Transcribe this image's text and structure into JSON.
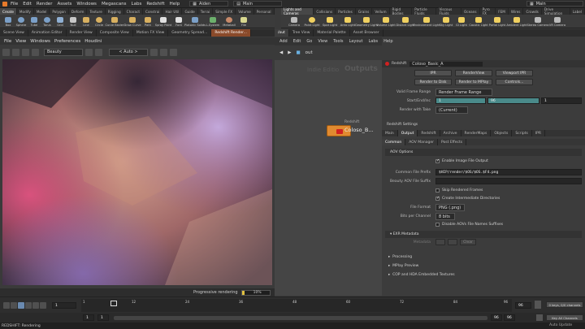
{
  "menubar": {
    "items": [
      "File",
      "Edit",
      "Render",
      "Assets",
      "Windows",
      "Megascans",
      "Labs",
      "Redshift",
      "Help"
    ],
    "desktop_left": "Aiden",
    "desktop_right": "Main",
    "desktop_far": "Main"
  },
  "shelf_left": {
    "tabs": [
      "Create",
      "Modify",
      "Model",
      "Polygon",
      "Deform",
      "Texture",
      "Rigging",
      "Charact",
      "Constrai",
      "Hair Util",
      "Guide",
      "Terrai",
      "Simple FX",
      "Volume",
      "Personal"
    ],
    "tools": [
      "Box",
      "Sphere",
      "Tube",
      "Torus",
      "Grid",
      "Null",
      "Line",
      "Circle",
      "Curve Bezier",
      "Draw Curve",
      "Path",
      "Spray Paint",
      "Font",
      "Platonic Solids",
      "L-System",
      "Metaball",
      "File"
    ]
  },
  "shelf_right": {
    "tabs": [
      "Lights and Cameras",
      "Collisions",
      "Particles",
      "Grains",
      "Vellum",
      "Rigid Bodies",
      "Particle Fluids",
      "Viscous Fluids",
      "Oceans",
      "Pyro FX",
      "FEM",
      "Wires",
      "Crowds",
      "Drive Simulation",
      "Label"
    ],
    "tools": [
      "Camera",
      "Point Light",
      "Spot Light",
      "Area Light",
      "Geometry Light",
      "Volume Light",
      "Distant Light",
      "Environment Light",
      "Sky Light",
      "GI Light",
      "Caustic Light",
      "Portal Light",
      "Ambient Light",
      "Stereo Camera",
      "VR Camera"
    ]
  },
  "panel_tabs_left": [
    "Scene View",
    "Animation Editor",
    "Render View",
    "Composite View",
    "Motion FX View",
    "Geometry Spread...",
    "Redshift Render..."
  ],
  "panel_tabs_right": [
    "/out",
    "Tree View",
    "Material Palette",
    "Asset Browser"
  ],
  "viewport": {
    "menu": [
      "File",
      "View",
      "Windows",
      "Preferences",
      "Houdini"
    ],
    "aov": "Beauty",
    "zoom": "< Auto >",
    "status": "Progressive rendering",
    "progress": "10%"
  },
  "node_panel": {
    "menu": [
      "Add",
      "Edit",
      "Go",
      "View",
      "Tools",
      "Layout",
      "Labs",
      "Help"
    ],
    "path": "out",
    "watermark_left": "Indie Editio",
    "watermark_right": "Outputs",
    "node_type": "Redshift",
    "node_name": "Coloso_B..."
  },
  "parm": {
    "header_type": "Redshift",
    "header_name": "Coloso_Basic_A",
    "buttons_row1": [
      "IPR",
      "RenderView",
      "Viewport IPR"
    ],
    "buttons_row2": [
      "Render to Disk",
      "Render to MPlay",
      "Controls..."
    ],
    "valid_frame_range_label": "Valid Frame Range",
    "valid_frame_range": "Render Frame Range",
    "start_end_label": "Start/End/Inc",
    "start": "1",
    "end": "96",
    "inc": "1",
    "render_with_take_label": "Render with Take",
    "render_with_take": "(Current)",
    "settings_label": "Redshift Settings",
    "tabs": [
      "Main",
      "Output",
      "Redshift",
      "Archive",
      "RenderMaps",
      "Objects",
      "Scripts",
      "IPR"
    ],
    "subtabs": [
      "Common",
      "AOV Manager",
      "Post Effects"
    ],
    "aov_options": "AOV Options",
    "enable_output": "Enable Image File Output",
    "prefix_label": "Common File Prefix",
    "prefix": "$HIP/render/$OS/$OS.$F4.png",
    "beauty_suffix_label": "Beauty AOV File Suffix",
    "skip_rendered": "Skip Rendered Frames",
    "create_dirs": "Create Intermediate Directories",
    "file_format_label": "File Format",
    "file_format": "PNG (.png)",
    "bits_label": "Bits per Channel",
    "bits": "8 bits",
    "disable_aov_suffix": "Disable AOVs File Names Suffixes",
    "exr_metadata": "EXR Metadata",
    "metadata_label": "Metadata",
    "clear": "Clear",
    "collapsed": [
      "Processing",
      "MPlay Preview",
      "COP and HDA Embedded Textures"
    ]
  },
  "timeline": {
    "frame": "1",
    "ticks": [
      "1",
      "12",
      "24",
      "36",
      "48",
      "60",
      "72",
      "84",
      "96"
    ],
    "end_box": "96",
    "start_box": "1",
    "range_start": "1",
    "range_end": "96",
    "range_end2": "96",
    "keys": "0 keys, 0/0 channels",
    "key_all": "Key All Channels",
    "auto_update": "Auto Update"
  },
  "footer": {
    "status": "REDSHIFT: Rendering"
  }
}
